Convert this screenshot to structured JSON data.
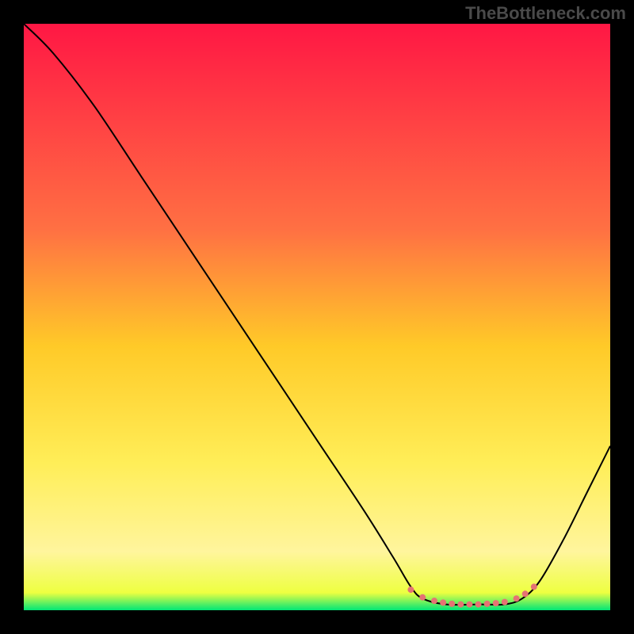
{
  "watermark": "TheBottleneck.com",
  "chart_data": {
    "type": "line",
    "title": "",
    "xlabel": "",
    "ylabel": "",
    "xlim": [
      0,
      100
    ],
    "ylim": [
      0,
      100
    ],
    "background": {
      "type": "vertical-gradient",
      "stops": [
        {
          "offset": 0,
          "color": "#ff1744"
        },
        {
          "offset": 35,
          "color": "#ff7043"
        },
        {
          "offset": 55,
          "color": "#ffca28"
        },
        {
          "offset": 75,
          "color": "#ffee58"
        },
        {
          "offset": 90,
          "color": "#fff59d"
        },
        {
          "offset": 97,
          "color": "#eeff41"
        },
        {
          "offset": 100,
          "color": "#00e676"
        }
      ]
    },
    "series": [
      {
        "name": "bottleneck-curve",
        "color": "#000000",
        "width": 2,
        "points": [
          {
            "x": 0,
            "y": 100
          },
          {
            "x": 5,
            "y": 95
          },
          {
            "x": 12,
            "y": 86
          },
          {
            "x": 20,
            "y": 74
          },
          {
            "x": 30,
            "y": 59
          },
          {
            "x": 40,
            "y": 44
          },
          {
            "x": 50,
            "y": 29
          },
          {
            "x": 58,
            "y": 17
          },
          {
            "x": 63,
            "y": 9
          },
          {
            "x": 66,
            "y": 4
          },
          {
            "x": 68,
            "y": 2
          },
          {
            "x": 72,
            "y": 1
          },
          {
            "x": 78,
            "y": 1
          },
          {
            "x": 82,
            "y": 1
          },
          {
            "x": 85,
            "y": 2
          },
          {
            "x": 88,
            "y": 5
          },
          {
            "x": 92,
            "y": 12
          },
          {
            "x": 96,
            "y": 20
          },
          {
            "x": 100,
            "y": 28
          }
        ]
      }
    ],
    "markers": {
      "name": "optimal-zone",
      "color": "#e57373",
      "radius": 4,
      "points": [
        {
          "x": 66,
          "y": 3.5
        },
        {
          "x": 68,
          "y": 2.2
        },
        {
          "x": 70,
          "y": 1.6
        },
        {
          "x": 71.5,
          "y": 1.3
        },
        {
          "x": 73,
          "y": 1.1
        },
        {
          "x": 74.5,
          "y": 1.0
        },
        {
          "x": 76,
          "y": 1.0
        },
        {
          "x": 77.5,
          "y": 1.0
        },
        {
          "x": 79,
          "y": 1.1
        },
        {
          "x": 80.5,
          "y": 1.2
        },
        {
          "x": 82,
          "y": 1.4
        },
        {
          "x": 84,
          "y": 2.0
        },
        {
          "x": 85.5,
          "y": 2.8
        },
        {
          "x": 87,
          "y": 4.0
        }
      ]
    }
  }
}
